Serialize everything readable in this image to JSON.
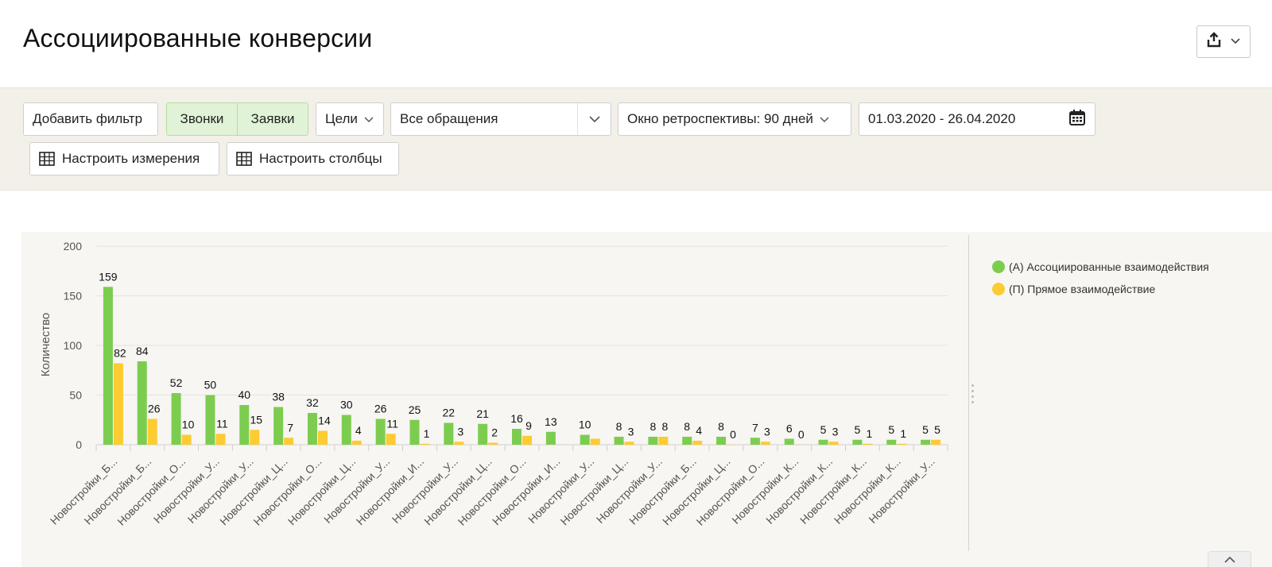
{
  "header": {
    "title": "Ассоциированные конверсии"
  },
  "toolbar": {
    "add_filter": "Добавить фильтр",
    "toggle": [
      "Звонки",
      "Заявки"
    ],
    "goals": "Цели",
    "requests_select": "Все обращения",
    "lookback": "Окно ретроспективы: 90 дней",
    "date_range": "01.03.2020 - 26.04.2020",
    "configure_dimensions": "Настроить измерения",
    "configure_columns": "Настроить столбцы"
  },
  "colors": {
    "assisted": "#7ccd4f",
    "direct": "#fdcb32",
    "toggle_bg": "#e1f3d6"
  },
  "chart_data": {
    "type": "bar",
    "ylabel": "Количество",
    "ylim": [
      0,
      200
    ],
    "yticks": [
      0,
      50,
      100,
      150,
      200
    ],
    "categories": [
      "Новостройки_Б...",
      "Новостройки_Б...",
      "Новостройки_О...",
      "Новостройки_У...",
      "Новостройки_У...",
      "Новостройки_Ц...",
      "Новостройки_О...",
      "Новостройки_Ц...",
      "Новостройки_У...",
      "Новостройки_И...",
      "Новостройки_У...",
      "Новостройки_Ц...",
      "Новостройки_О...",
      "Новостройки_И...",
      "Новостройки_У...",
      "Новостройки_Ц...",
      "Новостройки_У...",
      "Новостройки_Б...",
      "Новостройки_Ц...",
      "Новостройки_О...",
      "Новостройки_К...",
      "Новостройки_К...",
      "Новостройки_К...",
      "Новостройки_К...",
      "Новостройки_У..."
    ],
    "series": [
      {
        "name": "(А) Ассоциированные взаимодействия",
        "color": "#7ccd4f",
        "values": [
          159,
          84,
          52,
          50,
          40,
          38,
          32,
          30,
          26,
          25,
          22,
          21,
          16,
          13,
          10,
          8,
          8,
          8,
          8,
          7,
          6,
          5,
          5,
          5,
          5
        ]
      },
      {
        "name": "(П) Прямое взаимодействие",
        "color": "#fdcb32",
        "values": [
          82,
          26,
          10,
          11,
          15,
          7,
          14,
          4,
          11,
          1,
          3,
          2,
          9,
          null,
          6,
          3,
          8,
          4,
          0,
          3,
          0,
          3,
          1,
          1,
          5
        ],
        "value_labels": [
          "82",
          "26",
          "10",
          "11",
          "15",
          "7",
          "14",
          "4",
          "11",
          "1",
          "3",
          "2",
          "9",
          "",
          "",
          "3",
          "8",
          "4",
          "0",
          "3",
          "0",
          "3",
          "1",
          "1",
          "5"
        ]
      }
    ],
    "legend": "right"
  }
}
